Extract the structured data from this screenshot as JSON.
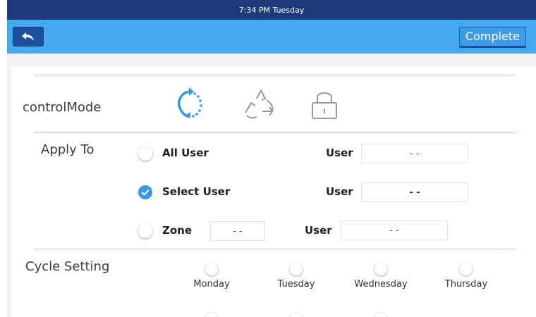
{
  "status": {
    "time_day": "7:34 PM  Tuesday"
  },
  "toolbar": {
    "back_icon": "back-arrow-icon",
    "complete_label": "Complete"
  },
  "control_mode": {
    "label": "controlMode",
    "modes": [
      {
        "icon": "cycle-icon",
        "active": true
      },
      {
        "icon": "recycle-icon",
        "active": false
      },
      {
        "icon": "lock-icon",
        "active": false
      }
    ]
  },
  "apply_to": {
    "label": "Apply To",
    "options": [
      {
        "label": "All User",
        "checked": false,
        "user_label": "User",
        "user_value": "- -"
      },
      {
        "label": "Select User",
        "checked": true,
        "user_label": "User",
        "user_value": "- -"
      },
      {
        "label": "Zone",
        "checked": false,
        "zone_value": "- -",
        "user_label": "User",
        "user_value": "- -"
      }
    ]
  },
  "cycle_setting": {
    "label": "Cycle Setting",
    "days": [
      "Monday",
      "Tuesday",
      "Wednesday",
      "Thursday"
    ]
  },
  "colors": {
    "accent": "#3a97e2",
    "header": "#46aaf0",
    "status_bar": "#1e3a78",
    "divider": "#a9cdee"
  }
}
